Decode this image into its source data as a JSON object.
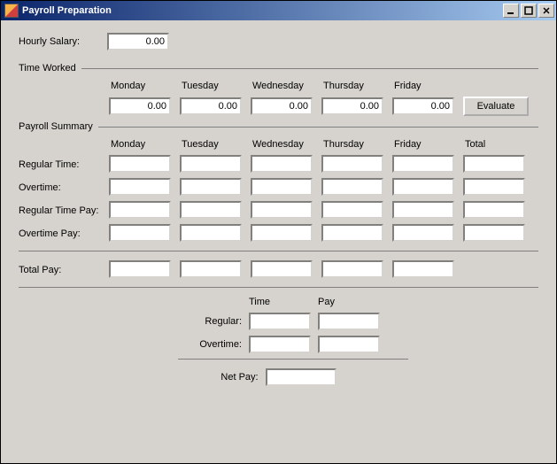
{
  "window": {
    "title": "Payroll Preparation"
  },
  "labels": {
    "hourly_salary": "Hourly Salary:",
    "time_worked": "Time Worked",
    "payroll_summary": "Payroll Summary",
    "evaluate": "Evaluate",
    "days": {
      "mon": "Monday",
      "tue": "Tuesday",
      "wed": "Wednesday",
      "thu": "Thursday",
      "fri": "Friday"
    },
    "total": "Total",
    "regular_time": "Regular Time:",
    "overtime": "Overtime:",
    "regular_time_pay": "Regular Time Pay:",
    "overtime_pay": "Overtime Pay:",
    "total_pay": "Total Pay:",
    "time": "Time",
    "pay": "Pay",
    "regular": "Regular:",
    "overtime2": "Overtime:",
    "net_pay": "Net Pay:"
  },
  "values": {
    "hourly_salary": "0.00",
    "time_worked": {
      "mon": "0.00",
      "tue": "0.00",
      "wed": "0.00",
      "thu": "0.00",
      "fri": "0.00"
    },
    "summary": {
      "regular_time": {
        "mon": "",
        "tue": "",
        "wed": "",
        "thu": "",
        "fri": "",
        "total": ""
      },
      "overtime": {
        "mon": "",
        "tue": "",
        "wed": "",
        "thu": "",
        "fri": "",
        "total": ""
      },
      "regular_pay": {
        "mon": "",
        "tue": "",
        "wed": "",
        "thu": "",
        "fri": "",
        "total": ""
      },
      "overtime_pay": {
        "mon": "",
        "tue": "",
        "wed": "",
        "thu": "",
        "fri": "",
        "total": ""
      },
      "total_pay": {
        "mon": "",
        "tue": "",
        "wed": "",
        "thu": "",
        "fri": ""
      }
    },
    "totals": {
      "regular": {
        "time": "",
        "pay": ""
      },
      "overtime": {
        "time": "",
        "pay": ""
      }
    },
    "net_pay": ""
  }
}
